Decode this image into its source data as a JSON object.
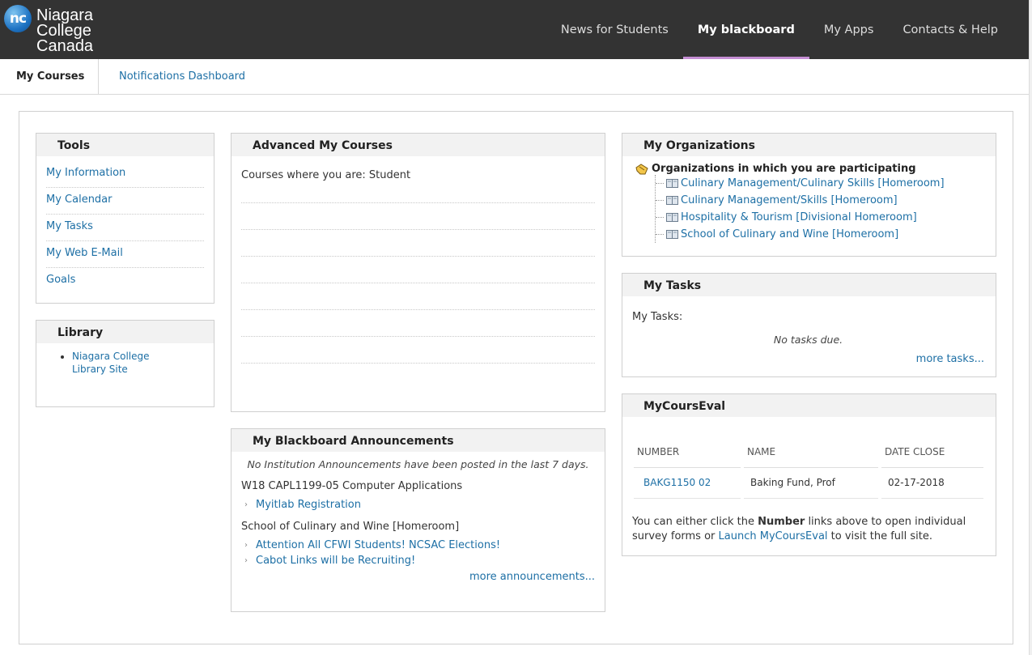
{
  "header": {
    "logo_badge": "nc",
    "logo_lines": [
      "Niagara",
      "College",
      "Canada"
    ],
    "nav": [
      {
        "label": "News for Students",
        "active": false
      },
      {
        "label": "My blackboard",
        "active": true
      },
      {
        "label": "My Apps",
        "active": false
      },
      {
        "label": "Contacts & Help",
        "active": false
      }
    ],
    "accent_color": "#c58ed4"
  },
  "subtabs": {
    "active": "My Courses",
    "other": "Notifications Dashboard"
  },
  "tools": {
    "title": "Tools",
    "items": [
      "My Information",
      "My Calendar",
      "My Tasks",
      "My Web E-Mail",
      "Goals"
    ]
  },
  "library": {
    "title": "Library",
    "link": "Niagara College Library Site"
  },
  "courses": {
    "title": "Advanced My Courses",
    "subtitle": "Courses where you are: Student"
  },
  "announcements": {
    "title": "My Blackboard Announcements",
    "none_note": "No Institution Announcements have been posted in the last 7 days.",
    "groups": [
      {
        "name": "W18 CAPL1199-05 Computer Applications",
        "items": [
          "Myitlab Registration"
        ]
      },
      {
        "name": "School of Culinary and Wine [Homeroom]",
        "items": [
          "Attention All CFWI Students! NCSAC Elections!",
          "Cabot Links will be Recruiting!"
        ]
      }
    ],
    "more": "more announcements..."
  },
  "organizations": {
    "title": "My Organizations",
    "heading": "Organizations in which you are participating",
    "items": [
      "Culinary Management/Culinary Skills [Homeroom]",
      "Culinary Management/Skills [Homeroom]",
      "Hospitality & Tourism [Divisional Homeroom]",
      "School of Culinary and Wine [Homeroom]"
    ]
  },
  "tasks": {
    "title": "My Tasks",
    "label": "My Tasks:",
    "empty": "No tasks due.",
    "more": "more tasks..."
  },
  "eval": {
    "title": "MyCoursEval",
    "columns": [
      "NUMBER",
      "NAME",
      "DATE CLOSE"
    ],
    "rows": [
      {
        "number": "BAKG1150 02",
        "name": "Baking Fund, Prof",
        "date": "02-17-2018"
      }
    ],
    "note_prefix": "You can either click the ",
    "note_bold": "Number",
    "note_mid": " links above to open individual survey forms or ",
    "note_link": "Launch MyCoursEval",
    "note_suffix": " to visit the full site."
  }
}
